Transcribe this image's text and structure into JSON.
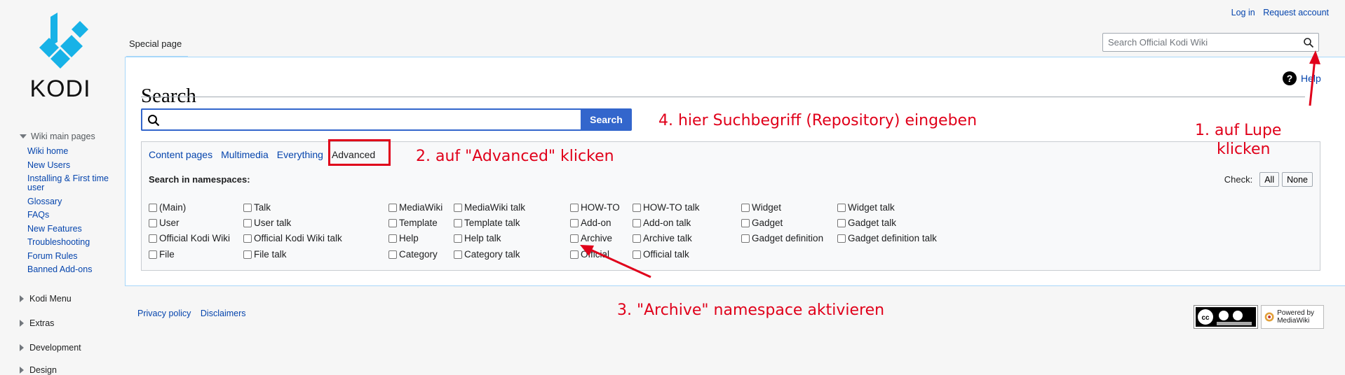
{
  "logo": {
    "text": "KODI"
  },
  "personal": {
    "login": "Log in",
    "request": "Request account"
  },
  "search": {
    "placeholder": "Search Official Kodi Wiki"
  },
  "tab": {
    "label": "Special page"
  },
  "page": {
    "title": "Search",
    "help": "Help",
    "search_button": "Search"
  },
  "sidebar": {
    "portal_main": "Wiki main pages",
    "items": [
      "Wiki home",
      "New Users",
      "Installing & First time user",
      "Glossary",
      "FAQs",
      "New Features",
      "Troubleshooting",
      "Forum Rules",
      "Banned Add-ons"
    ],
    "collapsed": [
      "Kodi Menu",
      "Extras",
      "Development",
      "Design"
    ]
  },
  "profiles": {
    "tabs": [
      "Content pages",
      "Multimedia",
      "Everything",
      "Advanced"
    ],
    "active": "Advanced",
    "namespaces_heading": "Search in namespaces:",
    "check_label": "Check:",
    "all": "All",
    "none": "None",
    "namespaces": [
      "(Main)",
      "Talk",
      "MediaWiki",
      "MediaWiki talk",
      "HOW-TO",
      "HOW-TO talk",
      "Widget",
      "Widget talk",
      "User",
      "User talk",
      "Template",
      "Template talk",
      "Add-on",
      "Add-on talk",
      "Gadget",
      "Gadget talk",
      "Official Kodi Wiki",
      "Official Kodi Wiki talk",
      "Help",
      "Help talk",
      "Archive",
      "Archive talk",
      "Gadget definition",
      "Gadget definition talk",
      "File",
      "File talk",
      "Category",
      "Category talk",
      "Official",
      "Official talk"
    ]
  },
  "footer": {
    "privacy": "Privacy policy",
    "disclaimers": "Disclaimers",
    "powered": "Powered by MediaWiki"
  },
  "annotations": {
    "step1_line1": "1. auf Lupe",
    "step1_line2": "klicken",
    "step2": "2. auf \"Advanced\" klicken",
    "step3": "3. \"Archive\" namespace aktivieren",
    "step4": "4. hier Suchbegriff (Repository) eingeben",
    "color": "#e0001a"
  },
  "colors": {
    "accent": "#3366cc",
    "link": "#0645ad"
  }
}
